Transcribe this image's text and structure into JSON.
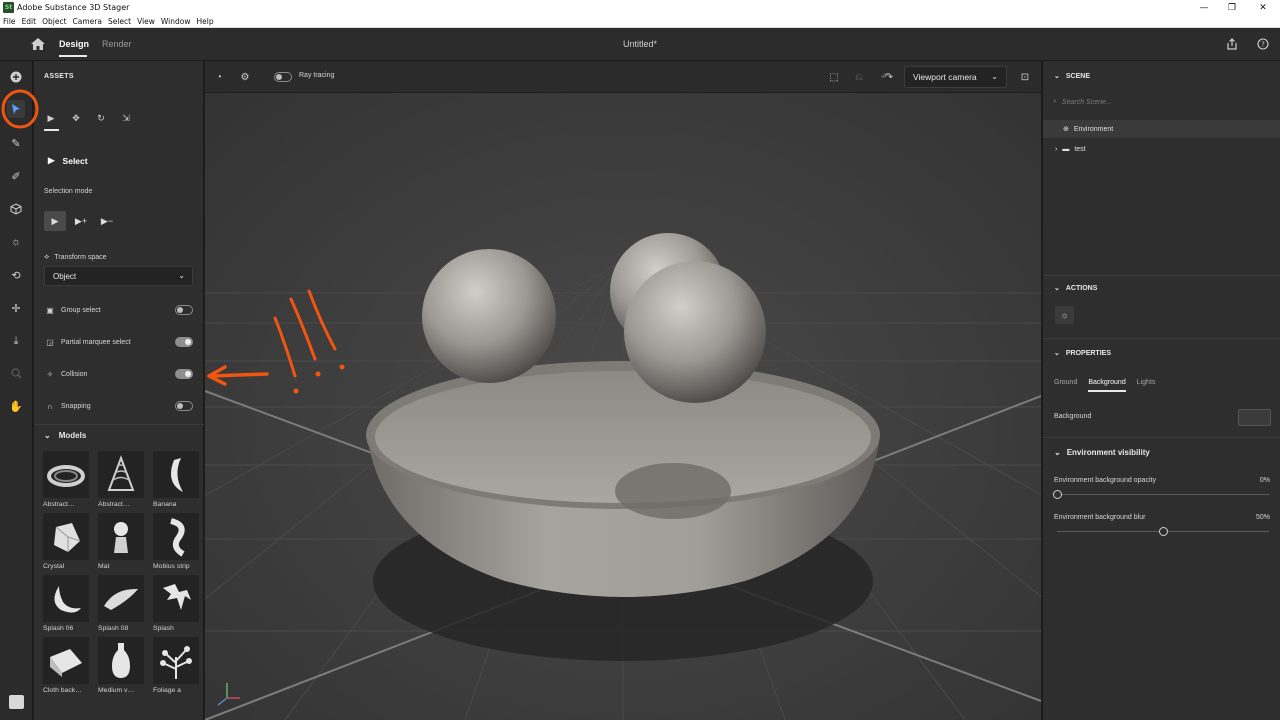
{
  "window": {
    "title": "Adobe Substance 3D Stager",
    "app_icon_text": "St",
    "controls": {
      "minimize": "—",
      "maximize": "❐",
      "close": "✕"
    }
  },
  "menubar": [
    "File",
    "Edit",
    "Object",
    "Camera",
    "Select",
    "View",
    "Window",
    "Help"
  ],
  "header": {
    "tabs": {
      "design": "Design",
      "render": "Render"
    },
    "document_title": "Untitled*"
  },
  "left_tools": [
    "add",
    "select",
    "magic-wand",
    "eyedropper",
    "cube",
    "light",
    "physics",
    "transform",
    "drop-to-floor",
    "zoom",
    "pan"
  ],
  "assets_panel": {
    "title": "ASSETS",
    "tool_name": "Select",
    "selection_mode_label": "Selection mode",
    "transform_space_label": "Transform space",
    "transform_space_value": "Object",
    "toggles": [
      {
        "label": "Group select",
        "on": false
      },
      {
        "label": "Partial marquee select",
        "on": true
      },
      {
        "label": "Collision",
        "on": true
      },
      {
        "label": "Snapping",
        "on": false
      }
    ],
    "models_title": "Models",
    "models": [
      {
        "name": "Abstract…"
      },
      {
        "name": "Abstract…"
      },
      {
        "name": "Banana"
      },
      {
        "name": "Crystal"
      },
      {
        "name": "Mat"
      },
      {
        "name": "Mobius strip"
      },
      {
        "name": "Splash 06"
      },
      {
        "name": "Splash 08"
      },
      {
        "name": "Splash"
      },
      {
        "name": "Cloth back…"
      },
      {
        "name": "Medium v…"
      },
      {
        "name": "Foliage a"
      }
    ]
  },
  "viewport": {
    "ray_tracing_label": "Ray tracing",
    "ray_tracing_on": false,
    "camera_label": "Viewport camera"
  },
  "scene_panel": {
    "title": "SCENE",
    "search_placeholder": "Search Scene...",
    "items": [
      {
        "label": "Environment",
        "selected": true
      },
      {
        "label": "test",
        "selected": false
      }
    ]
  },
  "actions_panel": {
    "title": "ACTIONS"
  },
  "properties_panel": {
    "title": "PROPERTIES",
    "tabs": [
      "Ground",
      "Background",
      "Lights"
    ],
    "active_tab": "Background",
    "background_label": "Background",
    "env_visibility_title": "Environment visibility",
    "opacity_label": "Environment background opacity",
    "opacity_value": "0%",
    "opacity_level": 0,
    "blur_label": "Environment background blur",
    "blur_value": "50%",
    "blur_level": 0.5
  },
  "colors": {
    "annotation": "#f2550f",
    "accent": "#5aa0ff"
  }
}
